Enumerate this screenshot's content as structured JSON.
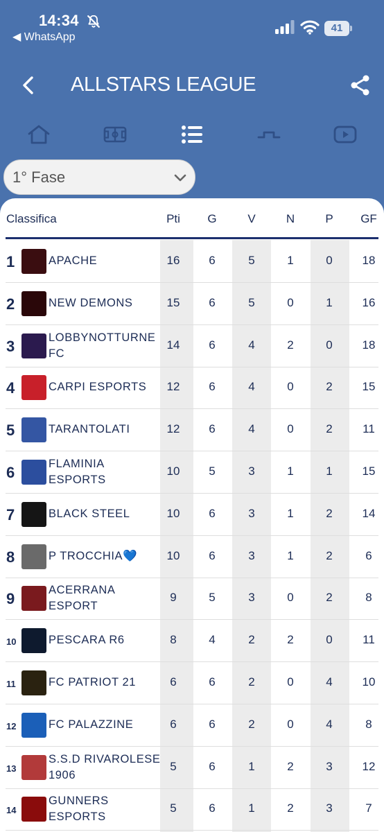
{
  "status_bar": {
    "time": "14:34",
    "back_app": "◀ WhatsApp",
    "battery": "41"
  },
  "header": {
    "title": "ALLSTARS LEAGUE"
  },
  "tabs": [
    {
      "name": "home",
      "icon": "home-icon"
    },
    {
      "name": "pitch",
      "icon": "pitch-icon"
    },
    {
      "name": "standings",
      "icon": "list-icon"
    },
    {
      "name": "bracket",
      "icon": "bracket-icon"
    },
    {
      "name": "video",
      "icon": "video-icon"
    }
  ],
  "phase": {
    "selected": "1° Fase"
  },
  "table": {
    "headers": {
      "classifica": "Classifica",
      "pti": "Pti",
      "g": "G",
      "v": "V",
      "n": "N",
      "p": "P",
      "gf": "GF"
    },
    "rows": [
      {
        "pos": "1",
        "team": "APACHE",
        "pti": "16",
        "g": "6",
        "v": "5",
        "n": "1",
        "p": "0",
        "gf": "18",
        "logo_color": "#3a0d10"
      },
      {
        "pos": "2",
        "team": "NEW DEMONS",
        "pti": "15",
        "g": "6",
        "v": "5",
        "n": "0",
        "p": "1",
        "gf": "16",
        "logo_color": "#2a0709"
      },
      {
        "pos": "3",
        "team": " LOBBYNOTTURNE FC",
        "pti": "14",
        "g": "6",
        "v": "4",
        "n": "2",
        "p": "0",
        "gf": "18",
        "logo_color": "#2b1a4e"
      },
      {
        "pos": "4",
        "team": "CARPI ESPORTS",
        "pti": "12",
        "g": "6",
        "v": "4",
        "n": "0",
        "p": "2",
        "gf": "15",
        "logo_color": "#c8202a"
      },
      {
        "pos": "5",
        "team": "TARANTOLATI",
        "pti": "12",
        "g": "6",
        "v": "4",
        "n": "0",
        "p": "2",
        "gf": "11",
        "logo_color": "#3456a3"
      },
      {
        "pos": "6",
        "team": "FLAMINIA ESPORTS",
        "pti": "10",
        "g": "5",
        "v": "3",
        "n": "1",
        "p": "1",
        "gf": "15",
        "logo_color": "#2c4e9e"
      },
      {
        "pos": "7",
        "team": "BLACK STEEL",
        "pti": "10",
        "g": "6",
        "v": "3",
        "n": "1",
        "p": "2",
        "gf": "14",
        "logo_color": "#151515"
      },
      {
        "pos": "8",
        "team": "P TROCCHIA💙",
        "pti": "10",
        "g": "6",
        "v": "3",
        "n": "1",
        "p": "2",
        "gf": "6",
        "logo_color": "#6a6a6a"
      },
      {
        "pos": "9",
        "team": "ACERRANA ESPORT",
        "pti": "9",
        "g": "5",
        "v": "3",
        "n": "0",
        "p": "2",
        "gf": "8",
        "logo_color": "#7a1a1e"
      },
      {
        "pos": "10",
        "team": "PESCARA R6",
        "pti": "8",
        "g": "4",
        "v": "2",
        "n": "2",
        "p": "0",
        "gf": "11",
        "logo_color": "#0e1a2e"
      },
      {
        "pos": "11",
        "team": "FC PATRIOT 21",
        "pti": "6",
        "g": "6",
        "v": "2",
        "n": "0",
        "p": "4",
        "gf": "10",
        "logo_color": "#2a2210"
      },
      {
        "pos": "12",
        "team": "FC PALAZZINE",
        "pti": "6",
        "g": "6",
        "v": "2",
        "n": "0",
        "p": "4",
        "gf": "8",
        "logo_color": "#1b5fb8"
      },
      {
        "pos": "13",
        "team": "S.S.D RIVAROLESE 1906",
        "pti": "5",
        "g": "6",
        "v": "1",
        "n": "2",
        "p": "3",
        "gf": "12",
        "logo_color": "#b23a3a"
      },
      {
        "pos": "14",
        "team": "GUNNERS ESPORTS",
        "pti": "5",
        "g": "6",
        "v": "1",
        "n": "2",
        "p": "3",
        "gf": "7",
        "logo_color": "#8a0c0c"
      }
    ]
  }
}
